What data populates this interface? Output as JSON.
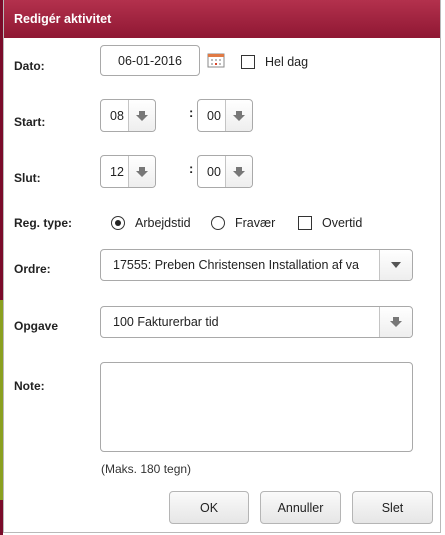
{
  "dialog": {
    "title": "Redigér aktivitet"
  },
  "date": {
    "label": "Dato:",
    "value": "06-01-2016",
    "all_day_label": "Hel dag",
    "all_day_checked": false
  },
  "start": {
    "label": "Start:",
    "hour": "08",
    "minute": "00",
    "separator": ":"
  },
  "end": {
    "label": "Slut:",
    "hour": "12",
    "minute": "00",
    "separator": ":"
  },
  "reg_type": {
    "label": "Reg. type:",
    "options": [
      "Arbejdstid",
      "Fravær"
    ],
    "selected": "Arbejdstid",
    "overtime_label": "Overtid",
    "overtime_checked": false
  },
  "order": {
    "label": "Ordre:",
    "value": "17555: Preben Christensen Installation af va"
  },
  "task": {
    "label": "Opgave",
    "value": "100 Fakturerbar tid"
  },
  "note": {
    "label": "Note:",
    "value": "",
    "hint": "(Maks. 180 tegn)"
  },
  "buttons": {
    "ok": "OK",
    "cancel": "Annuller",
    "delete": "Slet"
  },
  "icons": {
    "date_picker": "calendar-icon",
    "spinner": "arrow-down-icon",
    "order_dropdown": "caret-down-icon",
    "task_dropdown": "arrow-down-icon"
  },
  "colors": {
    "titlebar": "#a1233f",
    "background_accent_1": "#7a0b2a",
    "background_accent_2": "#8aa020"
  }
}
